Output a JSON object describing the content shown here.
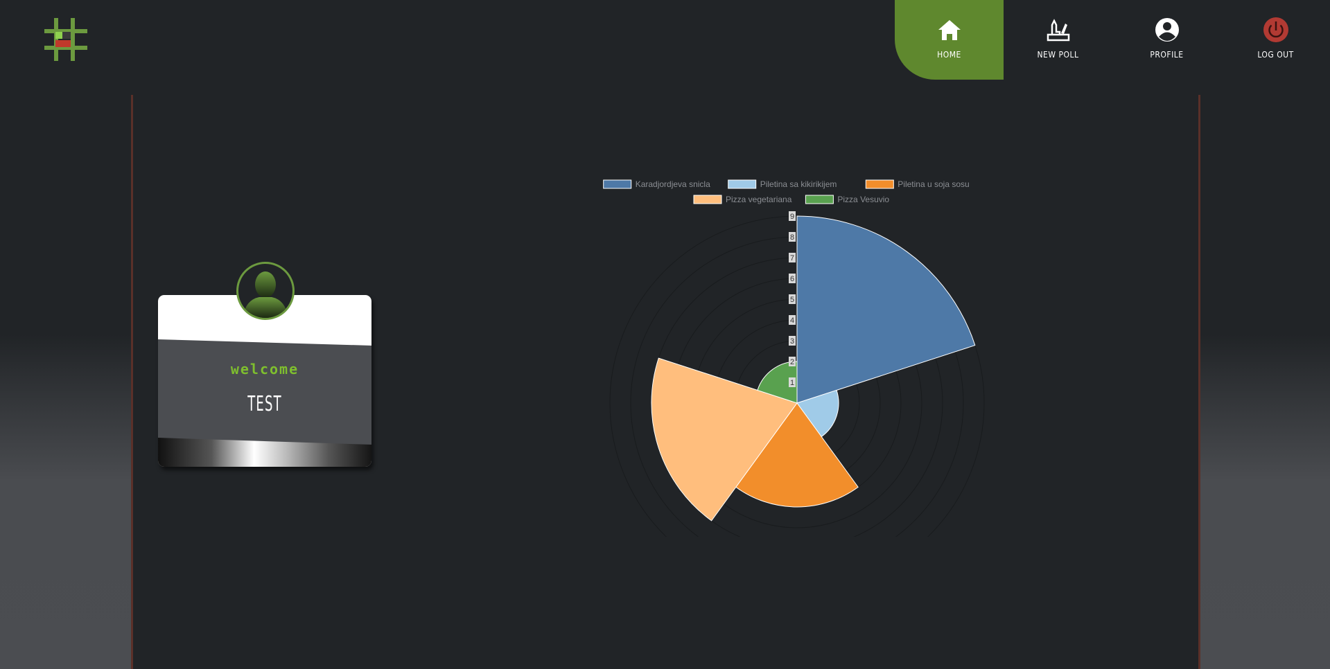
{
  "nav": {
    "items": [
      {
        "label": "HOME",
        "icon": "home-icon",
        "active": true
      },
      {
        "label": "NEW POLL",
        "icon": "new-poll-icon",
        "active": false
      },
      {
        "label": "PROFILE",
        "icon": "profile-icon",
        "active": false
      },
      {
        "label": "LOG OUT",
        "icon": "power-icon",
        "active": false
      }
    ]
  },
  "card": {
    "welcome": "welcome",
    "username": "TEST"
  },
  "colors": {
    "accent": "#5f882e",
    "welcome_green": "#7fbf2e",
    "logout_red": "#b23a33"
  },
  "chart_data": {
    "type": "polarArea",
    "categories": [
      "Karadjordjeva snicla",
      "Piletina sa kikirikijem",
      "Piletina u soja sosu",
      "Pizza vegetariana",
      "Pizza Vesuvio"
    ],
    "values": [
      9,
      2,
      5,
      7,
      2
    ],
    "colors": [
      "#4e79a7",
      "#a0cbe8",
      "#f28e2b",
      "#ffbe7d",
      "#59a14f"
    ],
    "rlim": [
      0,
      9
    ],
    "ticks": [
      "1",
      "2",
      "3",
      "4",
      "5",
      "6",
      "7",
      "8",
      "9"
    ],
    "legend": "top"
  }
}
